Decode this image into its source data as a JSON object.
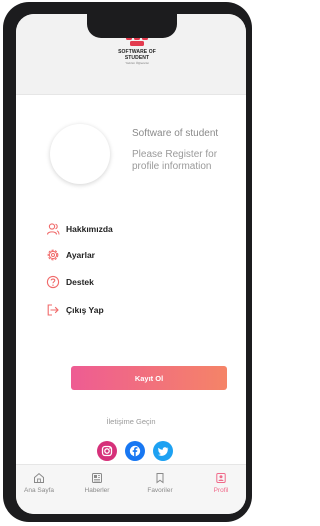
{
  "header": {
    "logo_text": "SOFTWARE OF\nSTUDENT",
    "logo_tagline": "Yazılım Öğrencisi"
  },
  "profile": {
    "name": "Software of student",
    "hint": "Please Register for profile information"
  },
  "menu": {
    "items": [
      {
        "label": "Hakkımızda",
        "icon": "user-icon"
      },
      {
        "label": "Ayarlar",
        "icon": "gear-icon"
      },
      {
        "label": "Destek",
        "icon": "help-circle-icon"
      },
      {
        "label": "Çıkış Yap",
        "icon": "logout-icon"
      }
    ]
  },
  "register_button": "Kayıt Ol",
  "contact": {
    "label": "İletişime Geçin",
    "links": [
      {
        "icon": "instagram-icon",
        "color": "#d6317a"
      },
      {
        "icon": "facebook-icon",
        "color": "#1877f2"
      },
      {
        "icon": "twitter-icon",
        "color": "#1da1f2"
      }
    ]
  },
  "tabbar": {
    "tabs": [
      {
        "label": "Ana Sayfa",
        "icon": "home-icon"
      },
      {
        "label": "Haberler",
        "icon": "newspaper-icon"
      },
      {
        "label": "Favoriler",
        "icon": "bookmark-icon"
      },
      {
        "label": "Profil",
        "icon": "profile-icon",
        "active": true
      }
    ]
  },
  "colors": {
    "accent": "#f06a8a",
    "button_gradient_start": "#ee5c93",
    "button_gradient_end": "#f58467",
    "menu_icon": "#f06a6a"
  }
}
